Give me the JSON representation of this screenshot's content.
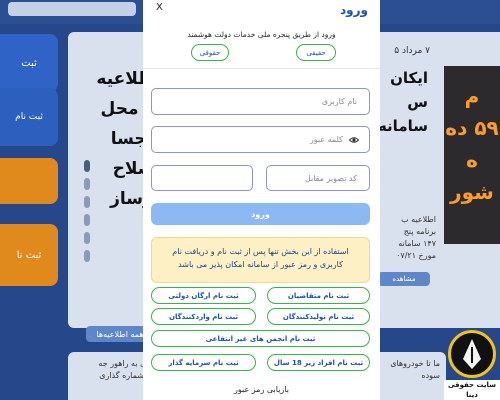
{
  "modal": {
    "title": "ورود",
    "close_label": "X",
    "subtitle": "ورود از طریق پنجره ملی خدمات دولت هوشمند",
    "person_type_real": "حقیقی",
    "person_type_legal": "حقوقی",
    "username_placeholder": "نام کاربری",
    "password_placeholder": "کلمه عبور",
    "captcha_placeholder": "کد تصویر مقابل",
    "login_label": "ورود",
    "notice": "استفاده از این بخش تنها پس از ثبت نام و دریافت نام کاربری و رمز عبور از سامانه امکان پذیر می باشد",
    "register_buttons": [
      "ثبت نام متقاضیان",
      "ثبت نام ارگان دولتی",
      "ثبت نام تولیدکنندگان",
      "ثبت نام واردکنندگان",
      "ثبت نام انجمن های غیر انتفاعی",
      "ثبت نام افراد زیر 18 سال",
      "ثبت نام سرمایه گذار"
    ],
    "recover_password": "بازیابی رمز عبور"
  },
  "background": {
    "tabs": [
      "ثبت",
      "ثبت نام",
      "",
      "ثبت نا"
    ],
    "headline_lines": [
      "اطلاعیه",
      "از محل",
      "پنجسا",
      "اصلاح",
      "نوساز"
    ],
    "date": "۷ مرداد ۵",
    "right_title_lines": [
      "ایکان",
      "س",
      "سامانه"
    ],
    "right_small_lines": [
      "اطلاعیه ب",
      "برنامه پنج",
      "۱۴۷ سامانه",
      "مورخ ۰۷/۲۱"
    ],
    "see_more": "مشاهده",
    "all_news": "همه اطلاعیه‌ها",
    "banner_lines": [
      "م",
      "۵۹ ده",
      "ه",
      "شور"
    ],
    "news_left": [
      "رسانی به راهور جه",
      "وقت شماره گذاری"
    ],
    "news_right": [
      "ما تا خودروهای",
      "سوده"
    ],
    "logo_caption": "سایت حقوقی دینا"
  }
}
